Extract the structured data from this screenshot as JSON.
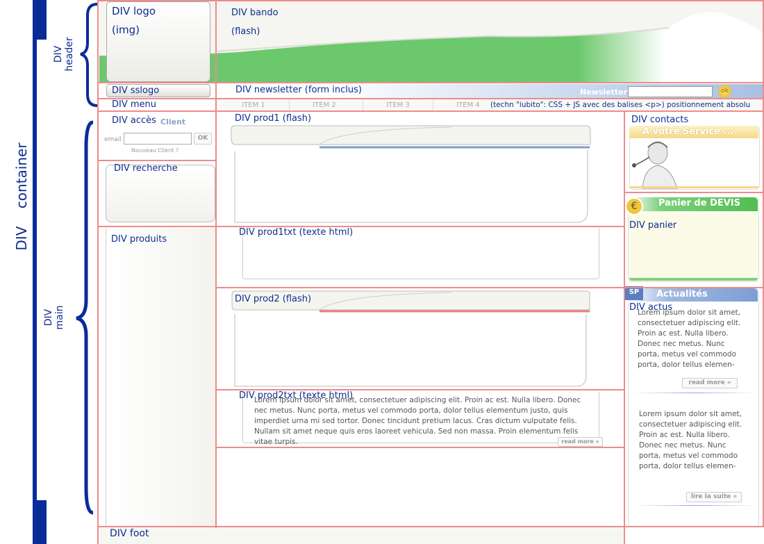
{
  "colors": {
    "accent_blue": "#0d2d8f",
    "frame_red": "#ef8a8a",
    "header_green": "#6cc86c"
  },
  "side": {
    "container": "DIV    container",
    "header": "DIV\nheader",
    "main": "DIV\nmain"
  },
  "header": {
    "logo": "DIV logo",
    "logo_img": "(img)",
    "bando": "DIV bando",
    "bando_flash": "(flash)",
    "sslogo": "DIV sslogo",
    "newsletter_div": "DIV newsletter (form inclus)",
    "newsletter_label": "Newsletter",
    "ok": "ok"
  },
  "menu": {
    "div": "DIV menu",
    "items": [
      "ITEM 1",
      "ITEM 2",
      "ITEM 3",
      "ITEM 4"
    ],
    "note": "(techn \"iubito\": CSS + JS avec des balises <p>)  positionnement absolu"
  },
  "acces": {
    "div": "DIV accès",
    "client": "Client",
    "email": "email",
    "ok": "OK",
    "nouveau": "Nouveau Client ?"
  },
  "recherche": {
    "div": "DIV recherche"
  },
  "produits": {
    "div": "DIV produits"
  },
  "prod1": {
    "div": "DIV prod1 (flash)"
  },
  "prod1txt": {
    "div": "DIV prod1txt (texte html)"
  },
  "prod2": {
    "div": "DIV prod2 (flash)"
  },
  "prod2txt": {
    "div": "DIV prod2txt (texte html)",
    "lorem": "Lorem ipsum dolor sit amet, consectetuer adipiscing elit. Proin ac est. Nulla libero. Donec nec metus. Nunc porta, metus vel commodo porta, dolor tellus elementum justo, quis imperdiet urna mi sed tortor. Donec tincidunt pretium lacus. Cras dictum vulputate felis. Nullam sit amet neque quis eros laoreet vehicula. Sed non massa. Proin elementum felis vitae turpis.",
    "readmore": "read more  »"
  },
  "contacts": {
    "div": "DIV contacts",
    "banner": "A votre Service ..."
  },
  "panier": {
    "banner": "Panier de DEVIS",
    "div": "DIV panier",
    "euro": "€"
  },
  "actus": {
    "banner": "Actualités",
    "div": "DIV actus",
    "badge": "SP",
    "lorem1": "Lorem ipsum dolor sit amet, consectetuer adipiscing elit. Proin ac est. Nulla libero. Donec nec metus. Nunc porta, metus vel commodo porta, dolor tellus elemen-",
    "readmore": "read more  »",
    "lorem2": "Lorem ipsum dolor sit amet, consectetuer adipiscing elit. Proin ac est. Nulla libero. Donec nec metus. Nunc porta, metus vel commodo porta, dolor tellus elemen-",
    "lire": "lire la suite  »"
  },
  "foot": {
    "div": "DIV foot"
  }
}
